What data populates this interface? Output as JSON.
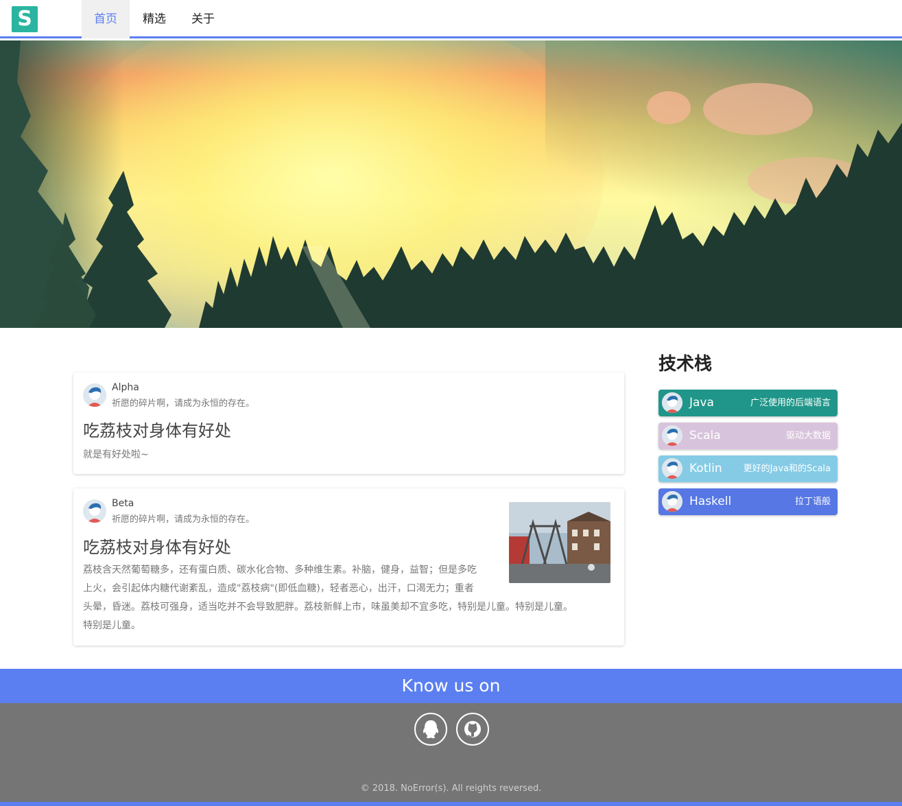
{
  "logo": {
    "letter": "S",
    "color": "#2bb5a0"
  },
  "nav": {
    "tabs": [
      {
        "label": "首页",
        "active": true
      },
      {
        "label": "精选",
        "active": false
      },
      {
        "label": "关于",
        "active": false
      }
    ],
    "accent": "#5b7ff0"
  },
  "carousel": {
    "slides": 2,
    "active_index": 1
  },
  "posts": [
    {
      "author": "Alpha",
      "motto": "祈愿的碎片啊，请成为永恒的存在。",
      "title": "吃荔枝对身体有好处",
      "body": "就是有好处啦~",
      "has_image": false
    },
    {
      "author": "Beta",
      "motto": "祈愿的碎片啊，请成为永恒的存在。",
      "title": "吃荔枝对身体有好处",
      "body_lines": [
        "荔枝含天然葡萄糖多，还有蛋白质、碳水化合物、多种维生素。补脑，健身，益智；但是多吃",
        "上火，会引起体内糖代谢紊乱，造成\"荔枝病\"(即低血糖)，轻者恶心，出汗，口渴无力；重者",
        "头晕，昏迷。荔枝可强身，适当吃并不会导致肥胖。荔枝新鲜上市，味虽美却不宜多吃，特别是儿童。特别是儿童。",
        "特别是儿童。"
      ],
      "has_image": true
    }
  ],
  "sidebar": {
    "title": "技术栈",
    "items": [
      {
        "name": "Java",
        "desc": "广泛使用的后端语言",
        "color": "#1f9689"
      },
      {
        "name": "Scala",
        "desc": "驱动大数据",
        "color": "#d8c3dc"
      },
      {
        "name": "Kotlin",
        "desc": "更好的Java和的Scala",
        "color": "#85cbe6"
      },
      {
        "name": "Haskell",
        "desc": "拉丁语般",
        "color": "#5677e4"
      }
    ]
  },
  "footer": {
    "know_us": "Know us on",
    "social_icons": [
      "qq-icon",
      "github-icon"
    ],
    "copyright": "© 2018. NoError(s). All reights reversed."
  }
}
